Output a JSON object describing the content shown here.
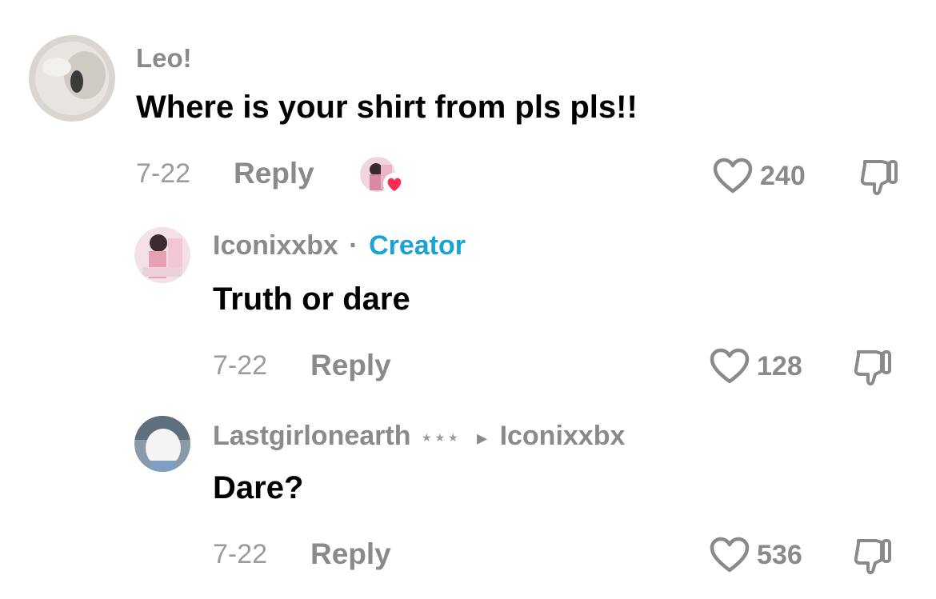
{
  "colors": {
    "username": "#8a8a8a",
    "meta": "#9b9b9b",
    "creator": "#1aa3d3",
    "heart_badge": "#fe2c55"
  },
  "comments": [
    {
      "username": "Leo!",
      "text": "Where is your shirt from pls pls!!",
      "date": "7-22",
      "reply_label": "Reply",
      "like_count": "240",
      "creator_liked": true
    },
    {
      "username": "Iconixxbx",
      "separator": "·",
      "badge": "Creator",
      "text": "Truth or dare",
      "date": "7-22",
      "reply_label": "Reply",
      "like_count": "128"
    },
    {
      "username": "Lastgirlonearth",
      "stars": "★★★",
      "reply_arrow": "▸",
      "reply_to": "Iconixxbx",
      "text": "Dare?",
      "date": "7-22",
      "reply_label": "Reply",
      "like_count": "536"
    }
  ]
}
